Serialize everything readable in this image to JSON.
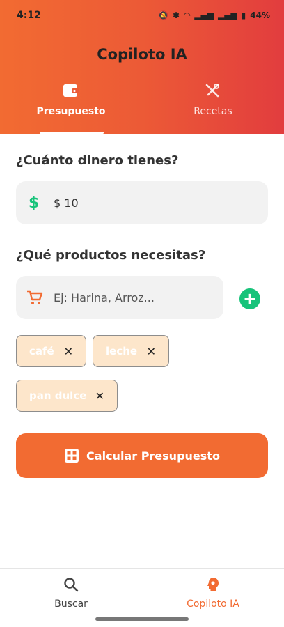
{
  "status_bar": {
    "time": "4:12",
    "battery": "44%"
  },
  "app": {
    "title": "Copiloto IA"
  },
  "tabs": [
    {
      "label": "Presupuesto",
      "icon": "wallet-icon",
      "active": true
    },
    {
      "label": "Recetas",
      "icon": "utensils-icon",
      "active": false
    }
  ],
  "money": {
    "title": "¿Cuánto dinero tienes?",
    "icon": "dollar-icon",
    "value": "$ 10"
  },
  "products": {
    "title": "¿Qué productos necesitas?",
    "icon": "cart-icon",
    "placeholder": "Ej: Harina, Arroz...",
    "chips": [
      {
        "label": "café"
      },
      {
        "label": "leche"
      },
      {
        "label": "pan dulce"
      }
    ]
  },
  "calculate": {
    "label": "Calcular Presupuesto",
    "icon": "calculator-icon"
  },
  "bottom_nav": [
    {
      "label": "Buscar",
      "icon": "search-icon",
      "active": false
    },
    {
      "label": "Copiloto IA",
      "icon": "brain-icon",
      "active": true
    }
  ],
  "colors": {
    "accent": "#f26b32",
    "header_end": "#e23d3e",
    "add": "#17c37a",
    "chip_bg": "#fde6cb"
  }
}
